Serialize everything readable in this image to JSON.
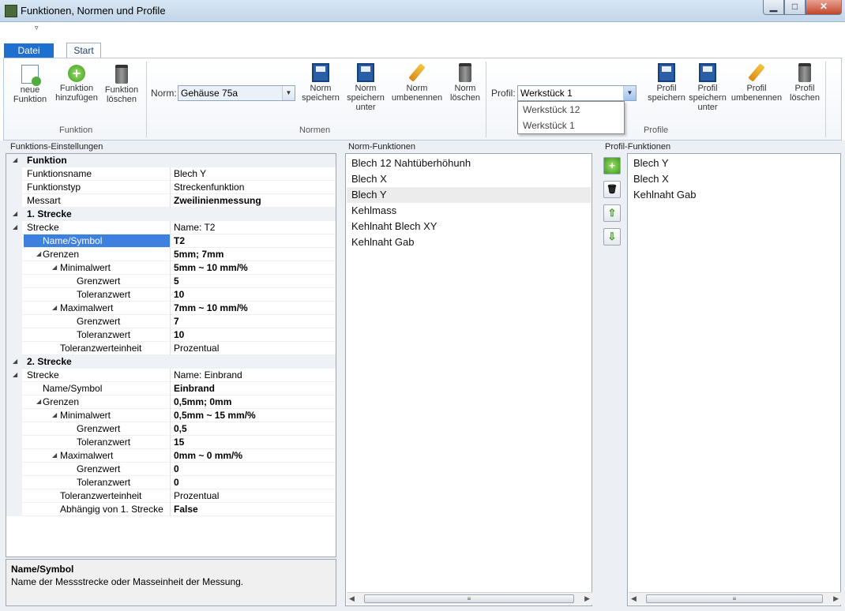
{
  "window": {
    "title": "Funktionen, Normen und Profile",
    "min": "▁",
    "max": "□",
    "close": "✕",
    "qat": "▿"
  },
  "tabs": {
    "datei": "Datei",
    "start": "Start"
  },
  "ribbon": {
    "neue_funktion": "neue\nFunktion",
    "funktion_hinzufuegen": "Funktion\nhinzufügen",
    "funktion_loeschen": "Funktion\nlöschen",
    "group_funktion": "Funktion",
    "norm_label": "Norm:",
    "norm_value": "Gehäuse 75a",
    "norm_speichern": "Norm\nspeichern",
    "norm_speichern_unter": "Norm\nspeichern\nunter",
    "norm_umbenennen": "Norm\numbenennen",
    "norm_loeschen": "Norm\nlöschen",
    "group_normen": "Normen",
    "profil_label": "Profil:",
    "profil_value": "Werkstück 1",
    "profil_options": [
      "Werkstück 12",
      "Werkstück 1"
    ],
    "profil_speichern": "Profil\nspeichern",
    "profil_speichern_unter": "Profil\nspeichern\nunter",
    "profil_umbenennen": "Profil\numbenennen",
    "profil_loeschen": "Profil\nlöschen",
    "group_profile": "Profile"
  },
  "panels": {
    "funktions_einstellungen": "Funktions-Einstellungen",
    "norm_funktionen": "Norm-Funktionen",
    "profil_funktionen": "Profil-Funktionen"
  },
  "property_grid": [
    {
      "type": "cat",
      "name": "Funktion"
    },
    {
      "name": "Funktionsname",
      "value": "Blech Y",
      "indent": 0
    },
    {
      "name": "Funktionstyp",
      "value": "Streckenfunktion",
      "indent": 0
    },
    {
      "name": "Messart",
      "value": "Zweilinienmessung",
      "indent": 0,
      "bold": true
    },
    {
      "type": "cat",
      "name": "1. Strecke"
    },
    {
      "name": "Strecke",
      "value": "Name: T2",
      "indent": 0,
      "exp": true
    },
    {
      "name": "Name/Symbol",
      "value": "T2",
      "indent": 1,
      "bold": true,
      "selected": true
    },
    {
      "name": "Grenzen",
      "value": "5mm; 7mm",
      "indent": 1,
      "bold": true,
      "exp": true
    },
    {
      "name": "Minimalwert",
      "value": "5mm ~ 10 mm/%",
      "indent": 2,
      "bold": true,
      "exp": true
    },
    {
      "name": "Grenzwert",
      "value": "5",
      "indent": 3,
      "bold": true
    },
    {
      "name": "Toleranzwert",
      "value": "10",
      "indent": 3,
      "bold": true
    },
    {
      "name": "Maximalwert",
      "value": "7mm ~ 10 mm/%",
      "indent": 2,
      "bold": true,
      "exp": true
    },
    {
      "name": "Grenzwert",
      "value": "7",
      "indent": 3,
      "bold": true
    },
    {
      "name": "Toleranzwert",
      "value": "10",
      "indent": 3,
      "bold": true
    },
    {
      "name": "Toleranzwerteinheit",
      "value": "Prozentual",
      "indent": 2
    },
    {
      "type": "cat",
      "name": "2. Strecke"
    },
    {
      "name": "Strecke",
      "value": "Name: Einbrand",
      "indent": 0,
      "exp": true
    },
    {
      "name": "Name/Symbol",
      "value": "Einbrand",
      "indent": 1,
      "bold": true
    },
    {
      "name": "Grenzen",
      "value": "0,5mm; 0mm",
      "indent": 1,
      "bold": true,
      "exp": true
    },
    {
      "name": "Minimalwert",
      "value": "0,5mm ~ 15 mm/%",
      "indent": 2,
      "bold": true,
      "exp": true
    },
    {
      "name": "Grenzwert",
      "value": "0,5",
      "indent": 3,
      "bold": true
    },
    {
      "name": "Toleranzwert",
      "value": "15",
      "indent": 3,
      "bold": true
    },
    {
      "name": "Maximalwert",
      "value": "0mm ~ 0 mm/%",
      "indent": 2,
      "bold": true,
      "exp": true
    },
    {
      "name": "Grenzwert",
      "value": "0",
      "indent": 3,
      "bold": true
    },
    {
      "name": "Toleranzwert",
      "value": "0",
      "indent": 3,
      "bold": true
    },
    {
      "name": "Toleranzwerteinheit",
      "value": "Prozentual",
      "indent": 2
    },
    {
      "name": "Abhängig von 1. Strecke",
      "value": "False",
      "indent": 2,
      "bold": true
    }
  ],
  "help": {
    "title": "Name/Symbol",
    "desc": "Name der Messstrecke oder Masseinheit der Messung."
  },
  "norm_list": [
    "Blech 12 Nahtüberhöhunh",
    "Blech X",
    "Blech Y",
    "Kehlmass",
    "Kehlnaht Blech XY",
    "Kehlnaht Gab"
  ],
  "norm_selected": 2,
  "profil_list": [
    "Blech Y",
    "Blech X",
    "Kehlnaht Gab"
  ],
  "side_buttons": {
    "add": "+",
    "delete": "🗑",
    "up": "⇧",
    "down": "⇩"
  }
}
